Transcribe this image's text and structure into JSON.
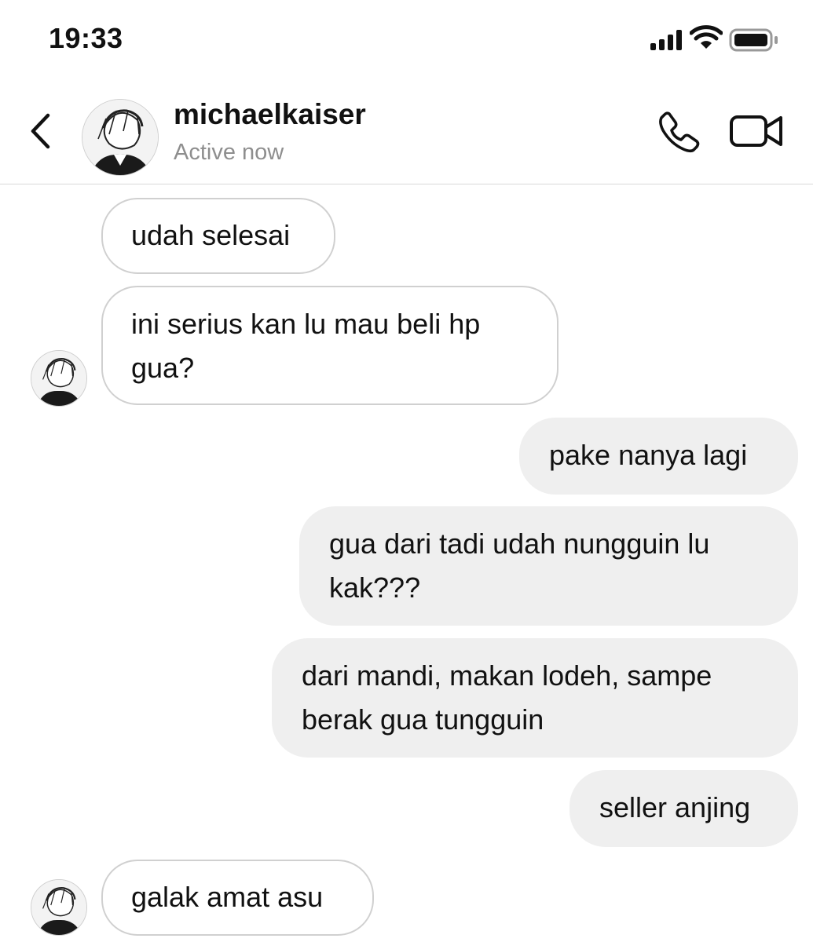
{
  "status_bar": {
    "time": "19:33",
    "icons": [
      "cellular-signal-icon",
      "wifi-icon",
      "battery-icon"
    ]
  },
  "header": {
    "back_icon": "chevron-left-icon",
    "username": "michaelkaiser",
    "presence": "Active now",
    "actions": [
      "phone-icon",
      "video-camera-icon"
    ]
  },
  "messages": [
    {
      "direction": "incoming",
      "text": "udah selesai"
    },
    {
      "direction": "incoming",
      "text": "ini serius kan lu mau beli hp\ngua?"
    },
    {
      "direction": "outgoing",
      "text": "pake nanya lagi"
    },
    {
      "direction": "outgoing",
      "text": "gua dari tadi udah nungguin lu\nkak???"
    },
    {
      "direction": "outgoing",
      "text": "dari mandi, makan lodeh, sampe\nberak gua tungguin"
    },
    {
      "direction": "outgoing",
      "text": "seller anjing"
    },
    {
      "direction": "incoming",
      "text": "galak amat asu"
    }
  ],
  "colors": {
    "incoming_bubble_border": "#d0d0d0",
    "outgoing_bubble_bg": "#efefef",
    "secondary_text": "#8e8e8e"
  }
}
